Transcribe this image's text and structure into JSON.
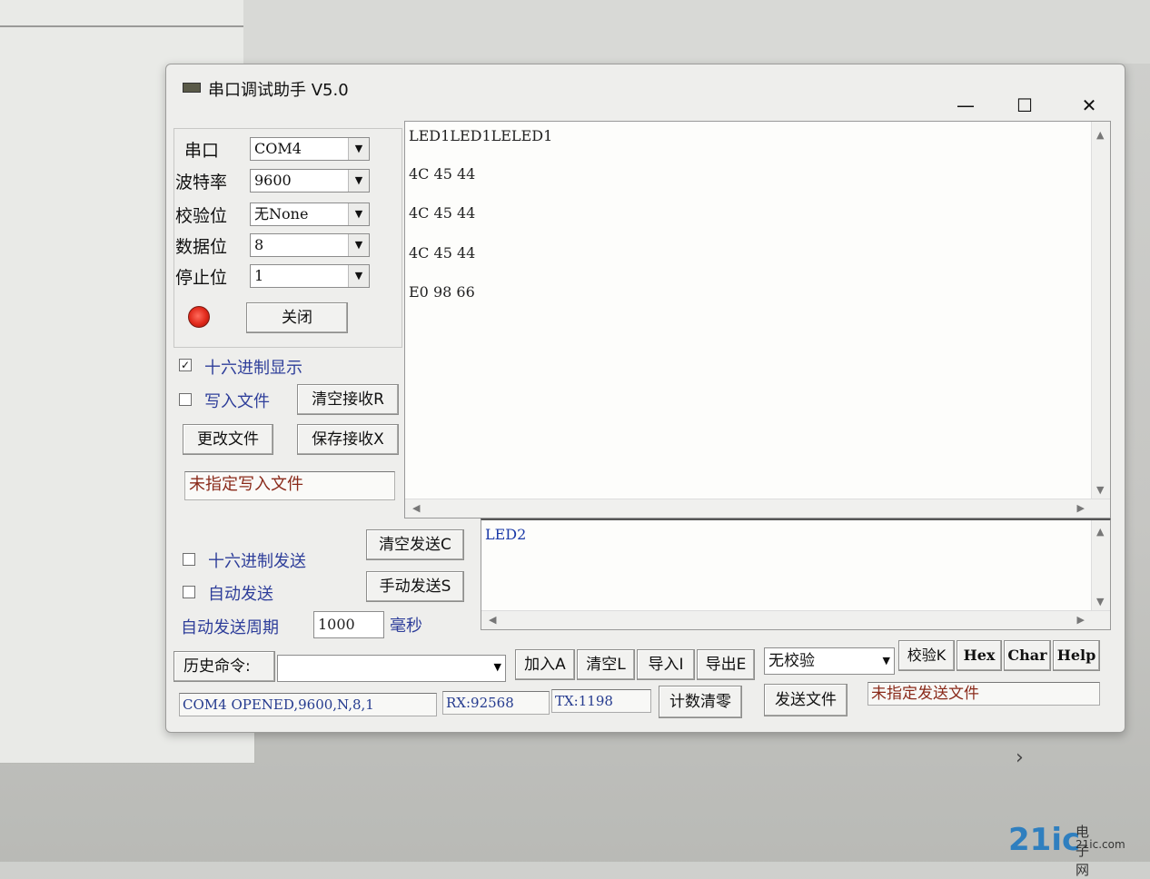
{
  "window": {
    "title": "串口调试助手 V5.0"
  },
  "controls": {
    "port": {
      "label": "串口",
      "value": "COM4"
    },
    "baud": {
      "label": "波特率",
      "value": "9600"
    },
    "parity": {
      "label": "校验位",
      "value": "无None"
    },
    "databits": {
      "label": "数据位",
      "value": "8"
    },
    "stopbits": {
      "label": "停止位",
      "value": "1"
    },
    "close_label": "关闭"
  },
  "receive": {
    "hex_display_label": "十六进制显示",
    "hex_display_checked": true,
    "write_file_label": "写入文件",
    "write_file_checked": false,
    "clear_label": "清空接收R",
    "change_file_label": "更改文件",
    "save_label": "保存接收X",
    "file_path": "未指定写入文件",
    "lines": [
      "LED1LED1LELED1",
      "4C 45 44",
      "4C 45 44",
      "4C 45 44",
      "E0 98 66"
    ]
  },
  "send": {
    "hex_send_label": "十六进制发送",
    "hex_send_checked": false,
    "auto_send_label": "自动发送",
    "auto_send_checked": false,
    "clear_label": "清空发送C",
    "manual_send_label": "手动发送S",
    "period_label": "自动发送周期",
    "period_value": "1000",
    "period_unit": "毫秒",
    "text": "LED2"
  },
  "toolbar": {
    "history_label": "历史命令:",
    "history_value": "",
    "add_label": "加入A",
    "clear_label": "清空L",
    "import_label": "导入I",
    "export_label": "导出E",
    "checksum_value": "无校验",
    "check_label": "校验K",
    "hex_label": "Hex",
    "char_label": "Char",
    "help_label": "Help"
  },
  "status": {
    "port_status": "COM4 OPENED,9600,N,8,1",
    "rx": "RX:92568",
    "tx": "TX:1198",
    "reset_count_label": "计数清零",
    "send_file_label": "发送文件",
    "send_file_path": "未指定发送文件"
  },
  "watermark": {
    "brand": "21ic",
    "sub": "电子网",
    "site": "21ic.com"
  }
}
